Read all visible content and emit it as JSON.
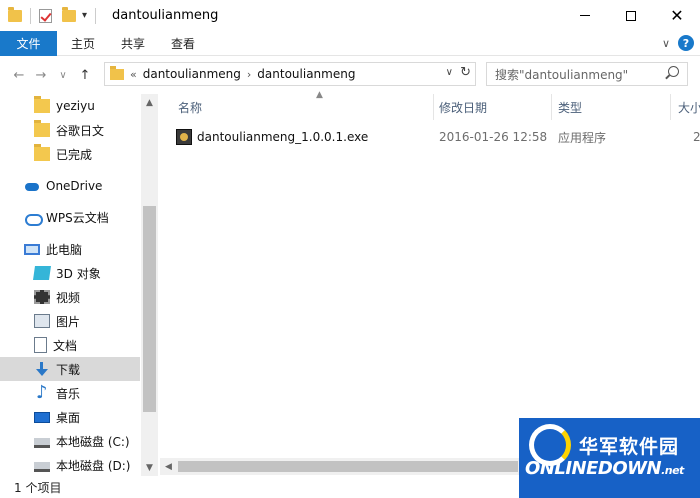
{
  "window": {
    "title": "dantoulianmeng"
  },
  "ribbon": {
    "file_tab": "文件",
    "tabs": [
      "主页",
      "共享",
      "查看"
    ]
  },
  "address": {
    "overflow": "«",
    "crumbs": [
      "dantoulianmeng",
      "dantoulianmeng"
    ]
  },
  "search": {
    "placeholder": "搜索\"dantoulianmeng\""
  },
  "sidebar": {
    "items": [
      {
        "label": "yeziyu",
        "icon": "folder-icon"
      },
      {
        "label": "谷歌日文",
        "icon": "folder-icon"
      },
      {
        "label": "已完成",
        "icon": "folder-icon"
      },
      {
        "label": "OneDrive",
        "icon": "onedrive-cloud-icon"
      },
      {
        "label": "WPS云文档",
        "icon": "wps-cloud-icon"
      },
      {
        "label": "此电脑",
        "icon": "this-pc-icon"
      },
      {
        "label": "3D 对象",
        "icon": "3d-objects-icon"
      },
      {
        "label": "视频",
        "icon": "video-icon"
      },
      {
        "label": "图片",
        "icon": "pictures-icon"
      },
      {
        "label": "文档",
        "icon": "documents-icon"
      },
      {
        "label": "下载",
        "icon": "download-icon",
        "selected": true
      },
      {
        "label": "音乐",
        "icon": "music-icon"
      },
      {
        "label": "桌面",
        "icon": "desktop-icon"
      },
      {
        "label": "本地磁盘 (C:)",
        "icon": "disk-icon"
      },
      {
        "label": "本地磁盘 (D:)",
        "icon": "disk-icon"
      }
    ]
  },
  "columns": {
    "name": "名称",
    "date": "修改日期",
    "type": "类型",
    "size": "大小"
  },
  "files": [
    {
      "name": "dantoulianmeng_1.0.0.1.exe",
      "date": "2016-01-26 12:58",
      "type": "应用程序",
      "size": "2"
    }
  ],
  "status": {
    "count": "1 个项目"
  },
  "watermark": {
    "top": "华军软件园",
    "bottom_main": "NLINEDOWN",
    "bottom_suffix": ".net"
  },
  "colors": {
    "accent": "#1979ca",
    "selected": "#d9d9d9",
    "watermark": "#1761c6"
  }
}
